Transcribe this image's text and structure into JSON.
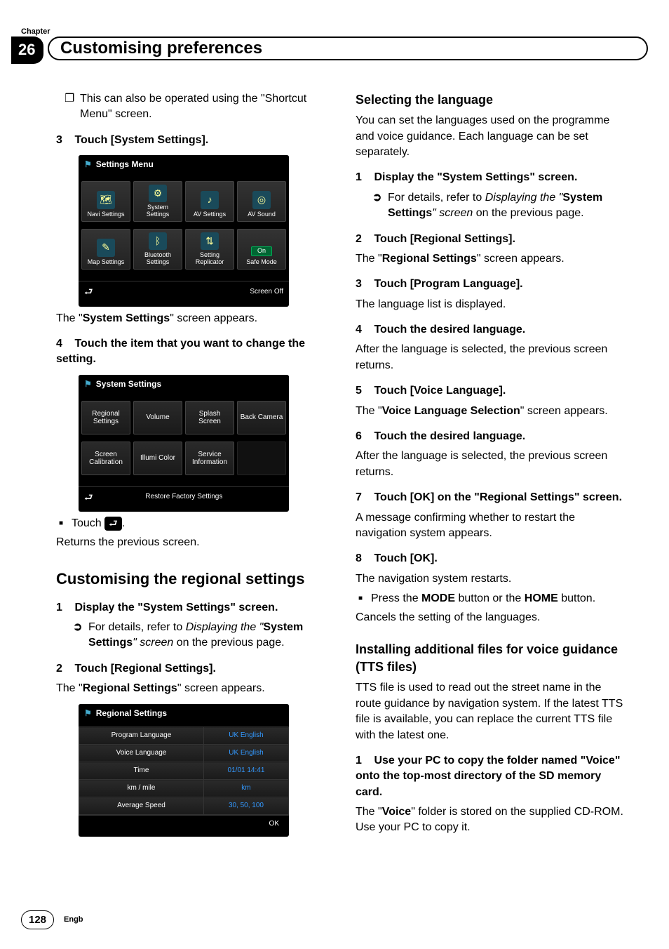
{
  "chapter": {
    "label": "Chapter",
    "number": "26",
    "title": "Customising preferences"
  },
  "page": {
    "number": "128",
    "lang": "Engb"
  },
  "col1": {
    "note1": "This can also be operated using the \"Shortcut Menu\" screen.",
    "step3_num": "3",
    "step3_txt": "Touch [System Settings].",
    "shot_settings": {
      "title": "Settings Menu",
      "cells": [
        "Navi Settings",
        "System Settings",
        "AV Settings",
        "AV Sound",
        "Map Settings",
        "Bluetooth Settings",
        "Setting Replicator",
        "Safe Mode"
      ],
      "on_label": "On",
      "footer_right": "Screen Off"
    },
    "after_settings_text_a": "The \"",
    "after_settings_text_bold": "System Settings",
    "after_settings_text_b": "\" screen appears.",
    "step4_num": "4",
    "step4_txt": "Touch the item that you want to change the setting.",
    "shot_system": {
      "title": "System Settings",
      "cells": [
        "Regional Settings",
        "Volume",
        "Splash Screen",
        "Back Camera",
        "Screen Calibration",
        "Illumi Color",
        "Service Information",
        ""
      ],
      "footer_center": "Restore Factory Settings"
    },
    "touch_back": "Touch ",
    "touch_back_after": ".",
    "returns_text": "Returns the previous screen.",
    "section_regional": "Customising the regional settings",
    "r_step1_num": "1",
    "r_step1_txt": "Display the \"System Settings\" screen.",
    "r_ref_a": "For details, refer to ",
    "r_ref_italic_a": "Displaying the \"",
    "r_ref_bold": "System Settings",
    "r_ref_italic_b": "\" screen",
    "r_ref_b": " on the previous page.",
    "r_step2_num": "2",
    "r_step2_txt": "Touch [Regional Settings].",
    "r_after_a": "The \"",
    "r_after_bold": "Regional Settings",
    "r_after_b": "\" screen appears.",
    "shot_regional": {
      "title": "Regional Settings",
      "rows": [
        {
          "l": "Program Language",
          "v": "UK English"
        },
        {
          "l": "Voice Language",
          "v": "UK English"
        },
        {
          "l": "Time",
          "v": "01/01 14:41"
        },
        {
          "l": "km / mile",
          "v": "km"
        },
        {
          "l": "Average Speed",
          "v": "30, 50, 100"
        }
      ],
      "ok": "OK"
    }
  },
  "col2": {
    "sub_lang": "Selecting the language",
    "lang_intro": "You can set the languages used on the programme and voice guidance. Each language can be set separately.",
    "l_step1_num": "1",
    "l_step1_txt": "Display the \"System Settings\" screen.",
    "l_ref_a": "For details, refer to ",
    "l_ref_italic_a": "Displaying the \"",
    "l_ref_bold": "System Settings",
    "l_ref_italic_b": "\" screen",
    "l_ref_b": " on the previous page.",
    "l_step2_num": "2",
    "l_step2_txt": "Touch [Regional Settings].",
    "l_after2_a": "The \"",
    "l_after2_bold": "Regional Settings",
    "l_after2_b": "\" screen appears.",
    "l_step3_num": "3",
    "l_step3_txt": "Touch [Program Language].",
    "l_after3": "The language list is displayed.",
    "l_step4_num": "4",
    "l_step4_txt": "Touch the desired language.",
    "l_after4": "After the language is selected, the previous screen returns.",
    "l_step5_num": "5",
    "l_step5_txt": "Touch [Voice Language].",
    "l_after5_a": "The \"",
    "l_after5_bold": "Voice Language Selection",
    "l_after5_b": "\" screen appears.",
    "l_step6_num": "6",
    "l_step6_txt": "Touch the desired language.",
    "l_after6": "After the language is selected, the previous screen returns.",
    "l_step7_num": "7",
    "l_step7_txt": "Touch [OK] on the \"Regional Settings\" screen.",
    "l_after7": "A message confirming whether to restart the navigation system appears.",
    "l_step8_num": "8",
    "l_step8_txt": "Touch [OK].",
    "l_after8": "The navigation system restarts.",
    "l_press_a": "Press the ",
    "l_press_bold1": "MODE",
    "l_press_mid": " button or the ",
    "l_press_bold2": "HOME",
    "l_press_b": " button.",
    "l_cancel": "Cancels the setting of the languages.",
    "sub_tts": "Installing additional files for voice guidance (TTS files)",
    "tts_intro": "TTS file is used to read out the street name in the route guidance by navigation system. If the latest TTS file is available, you can replace the current TTS file with the latest one.",
    "t_step1_num": "1",
    "t_step1_txt": "Use your PC to copy the folder named \"Voice\" onto the top-most directory of the SD memory card.",
    "t_after1_a": "The \"",
    "t_after1_bold": "Voice",
    "t_after1_b": "\" folder is stored on the supplied CD-ROM. Use your PC to copy it."
  }
}
